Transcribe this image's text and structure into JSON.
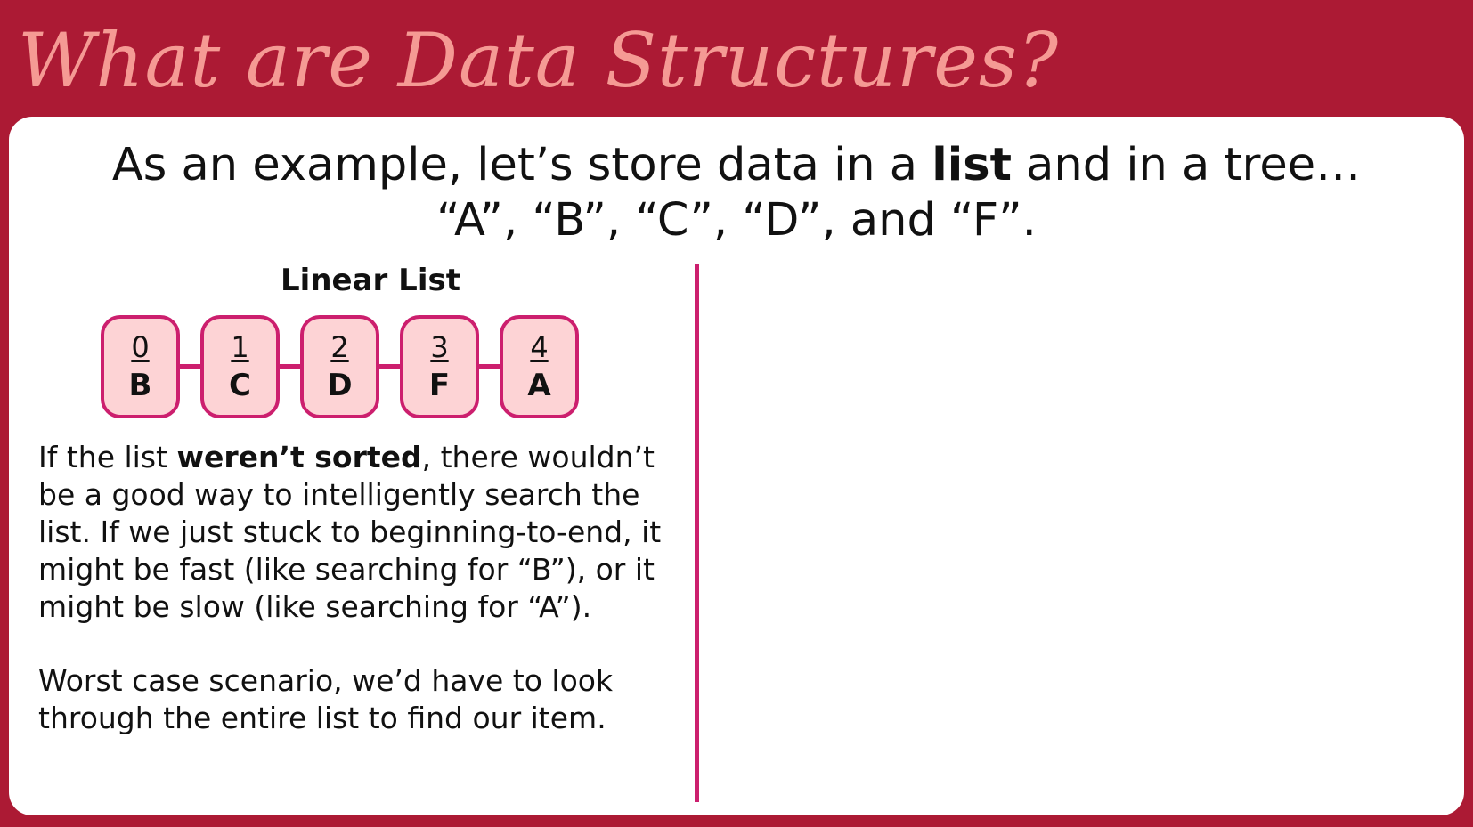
{
  "slide": {
    "title": "What are Data Structures?"
  },
  "intro": {
    "line1_before": "As an example, let’s store data in a ",
    "line1_bold": "list",
    "line1_after": " and in a tree…",
    "line2": "“A”, “B”, “C”, “D”, and “F”."
  },
  "linear_list": {
    "heading": "Linear List",
    "nodes": [
      {
        "index": "0",
        "value": "B"
      },
      {
        "index": "1",
        "value": "C"
      },
      {
        "index": "2",
        "value": "D"
      },
      {
        "index": "3",
        "value": "F"
      },
      {
        "index": "4",
        "value": "A"
      }
    ]
  },
  "explanation": {
    "p1_before": "If the list ",
    "p1_bold": "weren’t sorted",
    "p1_after": ", there wouldn’t be a good way to intelligently search the list. If we just stuck to beginning-to-end, it might be fast (like searching for “B”), or it might be slow (like searching for “A”).",
    "p2": "Worst case scenario, we’d have to look through the entire list to find our item."
  },
  "colors": {
    "frame_background": "#ac1a34",
    "title_text": "#f59a94",
    "accent": "#cc1f6e",
    "node_fill": "#fdd3d5",
    "card_background": "#ffffff"
  }
}
